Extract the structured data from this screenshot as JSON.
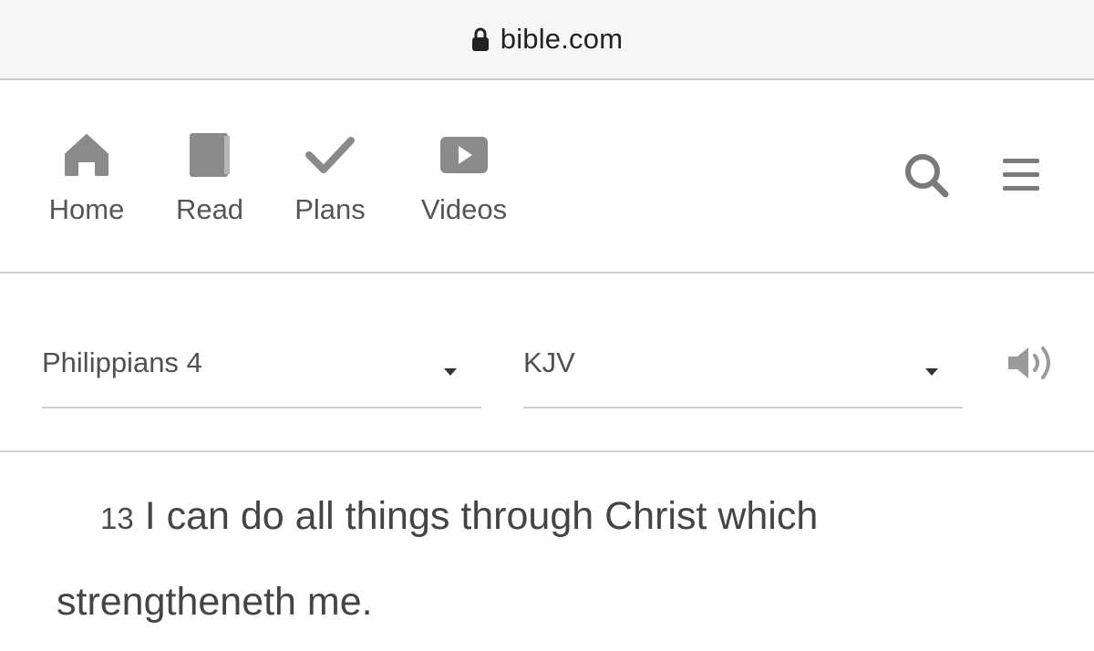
{
  "address_bar": {
    "url": "bible.com",
    "icon": "lock-icon"
  },
  "nav": {
    "items": [
      {
        "label": "Home",
        "icon": "home-icon"
      },
      {
        "label": "Read",
        "icon": "book-icon"
      },
      {
        "label": "Plans",
        "icon": "checkmark-icon"
      },
      {
        "label": "Videos",
        "icon": "play-icon"
      }
    ],
    "search_icon": "search-icon",
    "menu_icon": "hamburger-menu-icon"
  },
  "selectors": {
    "book": {
      "value": "Philippians 4",
      "icon": "chevron-down-icon"
    },
    "version": {
      "value": "KJV",
      "icon": "chevron-down-icon"
    },
    "audio_icon": "speaker-icon"
  },
  "verse": {
    "number": "13",
    "line1": "I can do all things through Christ which",
    "line2": "strengtheneth me."
  },
  "colors": {
    "icon_gray": "#8a8a8a",
    "text_gray": "#555555",
    "divider": "#cfcfcf",
    "address_bar_bg": "#f6f6f6"
  }
}
